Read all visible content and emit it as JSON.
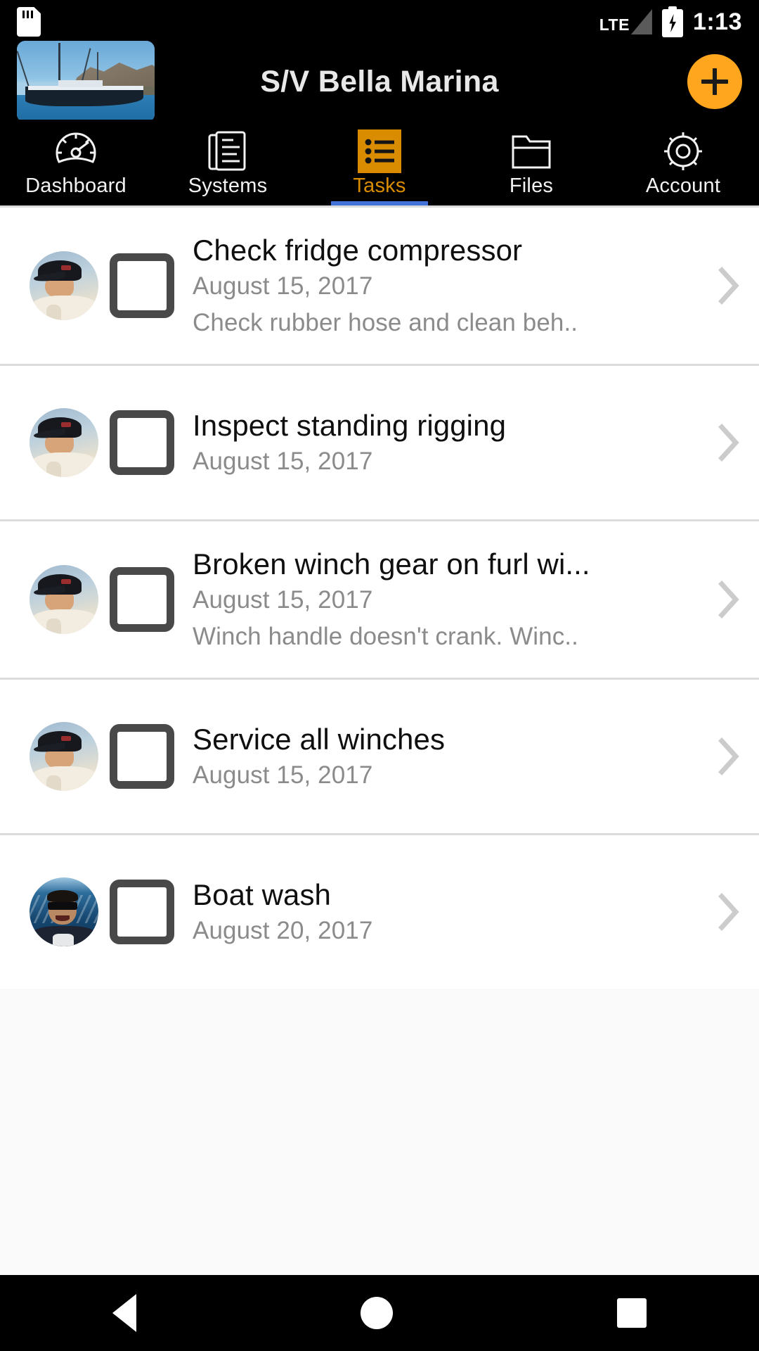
{
  "status_bar": {
    "sd_card_icon": "sd-card-icon",
    "network_type": "LTE",
    "signal_icon": "signal-bars-icon",
    "battery_icon": "battery-charging-icon",
    "time": "1:13"
  },
  "header": {
    "thumbnail_icon": "boat-thumbnail",
    "title": "S/V Bella Marina",
    "add_button_icon": "plus-icon",
    "add_button_color": "#FFA61E"
  },
  "tabs": [
    {
      "label": "Dashboard",
      "icon": "gauge-icon",
      "active": false
    },
    {
      "label": "Systems",
      "icon": "document-list-icon",
      "active": false
    },
    {
      "label": "Tasks",
      "icon": "bullet-list-icon",
      "active": true
    },
    {
      "label": "Files",
      "icon": "folder-icon",
      "active": false
    },
    {
      "label": "Account",
      "icon": "gear-icon",
      "active": false
    }
  ],
  "theme": {
    "accent_orange": "#D98C00",
    "tab_icon_orange": "#D98C00",
    "active_underline_blue": "#4273DB",
    "separator_gray": "#dcdcdc",
    "secondary_text_gray": "#8b8b8b",
    "chevron_gray": "#cccccc",
    "checkbox_border": "#494949"
  },
  "tasks": [
    {
      "avatar": "avatar-crew-cap",
      "checked": false,
      "title": "Check fridge compressor",
      "date": "August 15, 2017",
      "description": "Check rubber hose and clean beh..",
      "chevron": "chevron-right-icon"
    },
    {
      "avatar": "avatar-crew-cap",
      "checked": false,
      "title": "Inspect standing rigging",
      "date": "August 15, 2017",
      "description": "",
      "chevron": "chevron-right-icon"
    },
    {
      "avatar": "avatar-crew-cap",
      "checked": false,
      "title": "Broken winch gear on furl wi...",
      "date": "August 15, 2017",
      "description": "Winch handle doesn't crank. Winc..",
      "chevron": "chevron-right-icon"
    },
    {
      "avatar": "avatar-crew-cap",
      "checked": false,
      "title": "Service all winches",
      "date": "August 15, 2017",
      "description": "",
      "chevron": "chevron-right-icon"
    },
    {
      "avatar": "avatar-crew-sunglasses",
      "checked": false,
      "title": "Boat wash",
      "date": "August 20, 2017",
      "description": "",
      "chevron": "chevron-right-icon"
    }
  ],
  "nav_bar": {
    "back_icon": "back-triangle-icon",
    "home_icon": "home-circle-icon",
    "recents_icon": "recents-square-icon"
  }
}
